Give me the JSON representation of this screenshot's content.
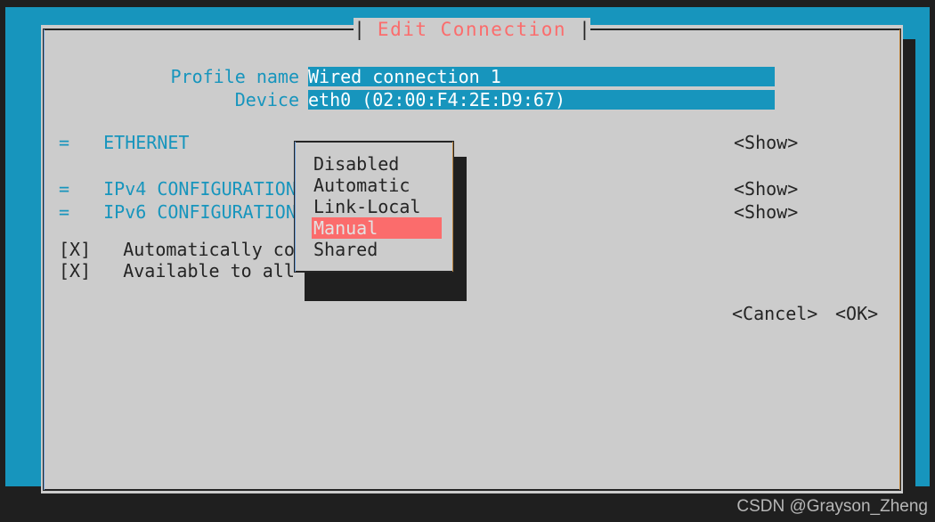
{
  "theme": {
    "backdrop": "#1795bd",
    "dialog_bg": "#cccccc",
    "accent_cyan": "#1795bd",
    "accent_salmon": "#fb6c6c",
    "text_dark": "#242424",
    "shadow": "#1f1f1f"
  },
  "dialog": {
    "title": "Edit Connection",
    "title_pipe_left": "|",
    "title_pipe_right": "|"
  },
  "fields": [
    {
      "label": "Profile name",
      "value": "Wired connection 1",
      "filler": "______________________"
    },
    {
      "label": "Device",
      "value": "eth0 (02:00:F4:2E:D9:67)",
      "filler": "________________"
    }
  ],
  "sections": [
    {
      "marker": "=",
      "label": "ETHERNET",
      "show_label": "<Show>"
    },
    {
      "marker": "=",
      "label": "IPv4 CONFIGURATION",
      "show_label": "<Show>"
    },
    {
      "marker": "=",
      "label": "IPv6 CONFIGURATION",
      "show_label": "<Show>"
    }
  ],
  "checkboxes": [
    {
      "box": "[X]",
      "label": "Automatically co"
    },
    {
      "box": "[X]",
      "label": "Available to all"
    }
  ],
  "buttons": {
    "cancel": "<Cancel>",
    "ok": "<OK>"
  },
  "dropdown": {
    "name": "ipv4-configuration-method",
    "options": [
      {
        "label": "Disabled",
        "selected": false
      },
      {
        "label": "Automatic",
        "selected": false
      },
      {
        "label": "Link-Local",
        "selected": false
      },
      {
        "label": "Manual",
        "selected": true
      },
      {
        "label": "Shared",
        "selected": false
      }
    ],
    "selected_value": "Manual"
  },
  "watermark": "CSDN @Grayson_Zheng"
}
